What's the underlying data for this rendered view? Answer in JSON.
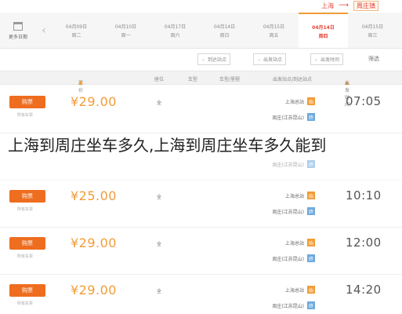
{
  "route": {
    "from": "上海",
    "to": "周庄镇"
  },
  "calendar": {
    "label": "更多日期"
  },
  "date_tabs": [
    {
      "date": "04月09日",
      "weekday": "周二",
      "active": false
    },
    {
      "date": "04月10日",
      "weekday": "周一",
      "active": false
    },
    {
      "date": "04月17日",
      "weekday": "周六",
      "active": false
    },
    {
      "date": "04月14日",
      "weekday": "周日",
      "active": false
    },
    {
      "date": "04月15日",
      "weekday": "周五",
      "active": false
    },
    {
      "date": "04月14日",
      "weekday": "周四",
      "active": true
    },
    {
      "date": "04月15日",
      "weekday": "周三",
      "active": false
    }
  ],
  "filters": {
    "label": "筛选",
    "dropdowns": [
      "出发时间",
      "出发站点",
      "到达站点"
    ]
  },
  "columns": {
    "depart_time": "出发时间",
    "stations": "出发站点/到达站点",
    "vehicle": "车型/里程",
    "type": "车型",
    "seat": "座位",
    "price": "票价",
    "action": "购票"
  },
  "rows": [
    {
      "time": "07:05",
      "price": "¥29.00",
      "seat": "全",
      "dep": "上海总站",
      "arr": "周庄(江苏昆山)",
      "button": "购票",
      "status": "所有车票"
    },
    {
      "time": "10:10",
      "price": "¥25.00",
      "seat": "全",
      "dep": "上海总站",
      "arr": "周庄(江苏昆山)",
      "button": "购票",
      "status": "所有车票"
    },
    {
      "time": "12:00",
      "price": "¥29.00",
      "seat": "全",
      "dep": "上海总站",
      "arr": "周庄(江苏昆山)",
      "button": "购票",
      "status": "所有车票"
    },
    {
      "time": "14:20",
      "price": "¥29.00",
      "seat": "全",
      "dep": "上海总站",
      "arr": "周庄(江苏昆山)",
      "button": "购票",
      "status": "所有车票"
    }
  ],
  "overlay_title": "上海到周庄坐车多久,上海到周庄坐车多久能到"
}
